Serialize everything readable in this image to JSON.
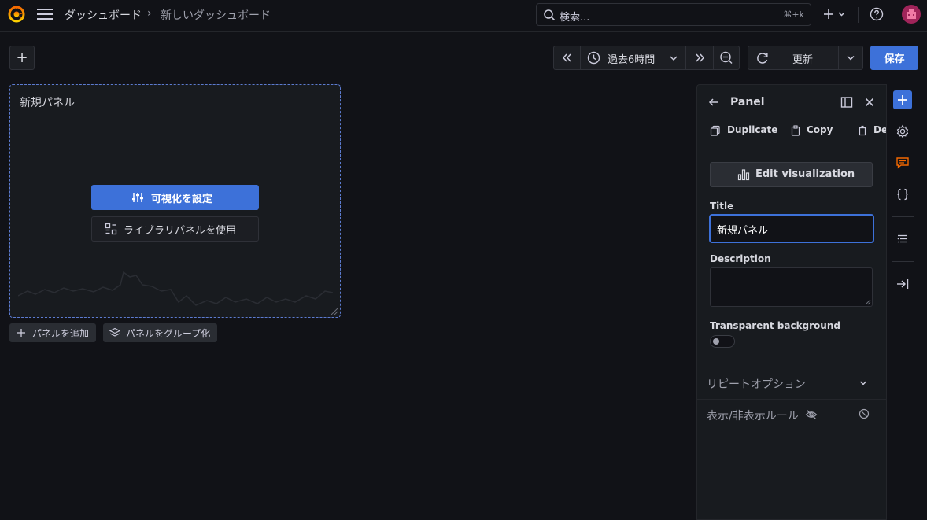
{
  "topbar": {
    "breadcrumb": [
      "ダッシュボード",
      "新しいダッシュボード"
    ],
    "breadcrumb_sep": "›",
    "search_placeholder": "検索...",
    "search_shortcut": "⌘+k"
  },
  "toolbar": {
    "add_label": "+",
    "time_range": "過去6時間",
    "refresh_label": "更新",
    "save_label": "保存"
  },
  "panel": {
    "title": "新規パネル",
    "configure_viz_label": "可視化を設定",
    "library_panel_label": "ライブラリパネルを使用"
  },
  "below_panel": {
    "add_panel_label": "パネルを追加",
    "group_panels_label": "パネルをグループ化"
  },
  "edit_pane": {
    "header": "Panel",
    "actions": [
      "Duplicate",
      "Copy",
      "De"
    ],
    "edit_viz_label": "Edit visualization",
    "title_label": "Title",
    "title_value": "新規パネル",
    "description_label": "Description",
    "description_value": "",
    "transparent_label": "Transparent background",
    "transparent_on": false,
    "repeat_options_label": "リピートオプション",
    "visibility_rules_label": "表示/非表示ルール"
  },
  "colors": {
    "accent": "#3d71d9",
    "brand": "#f46800",
    "panel_border": "#5c7bd1"
  },
  "icons": [
    "grafana-logo-icon",
    "menu-icon",
    "search-icon",
    "plus-icon",
    "chevron-down-icon",
    "help-icon",
    "avatar-icon",
    "zoom-out-icon",
    "refresh-icon",
    "clock-icon",
    "arrow-left-icon",
    "dock-icon",
    "close-icon",
    "copy-icon",
    "trash-icon",
    "bar-chart-icon",
    "settings-icon",
    "comment-icon",
    "braces-icon",
    "outline-icon",
    "collapse-icon",
    "eye-off-icon",
    "block-icon",
    "sliders-icon",
    "library-icon",
    "layers-icon"
  ]
}
